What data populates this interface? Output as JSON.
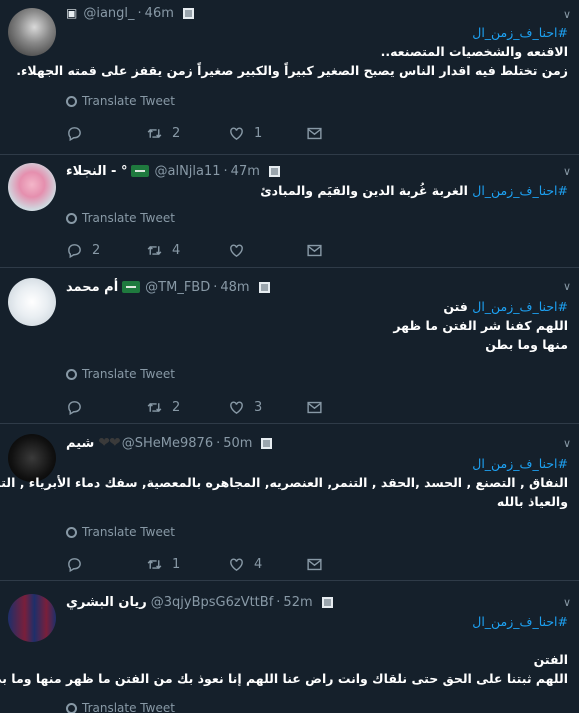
{
  "tweets": [
    {
      "name": "",
      "handle": "@iangl_",
      "time": "46m",
      "text_lines": [
        "#احنا_ف_زمن_ال",
        "الاقنعه والشخصيات المتصنعه..",
        "زمن تختلط فيه اقدار الناس يصبح الصغير كبيراً والكبير صغيراً زمن يقفز على قمته الجهلاء."
      ],
      "translate_label": "Translate Tweet",
      "replies": "",
      "retweets": "2",
      "likes": "1"
    },
    {
      "name": "النجلاء - °",
      "handle": "@alNjla11",
      "time": "47m",
      "text_lines": [
        "#احنا_ف_زمن_ال  الغربة غُربة الدين والقيَم والمبادئ"
      ],
      "translate_label": "Translate Tweet",
      "replies": "2",
      "retweets": "4",
      "likes": ""
    },
    {
      "name": "أم محمد",
      "handle": "@TM_FBD",
      "time": "48m",
      "text_lines": [
        "#احنا_ف_زمن_ال فتن",
        "اللهم كفنا شر الفتن ما ظهر",
        "منها وما بطن"
      ],
      "translate_label": "Translate Tweet",
      "replies": "",
      "retweets": "2",
      "likes": "3"
    },
    {
      "name": "شيم",
      "handle": "@SHeMe9876",
      "time": "50m",
      "text_lines": [
        "#احنا_ف_زمن_ال",
        "النفاق , التصنع , الحسد ,الحقد , التنمر, العنصريه, المجاهره بالمعصية, سفك دماء الأبرياء , التشهير بالفضايح",
        "والعياذ بالله"
      ],
      "translate_label": "Translate Tweet",
      "replies": "",
      "retweets": "1",
      "likes": "4"
    },
    {
      "name": "ريان البشري",
      "handle": "@3qjyBpsG6zVttBf",
      "time": "52m",
      "text_lines": [
        "#احنا_ف_زمن_ال",
        "",
        "الفتن",
        "اللهم ثبتنا على الحق حتى نلقاك وانت راض عنا اللهم إنا نعوذ بك من الفتن ما ظهر منها وما بطن"
      ],
      "translate_label": "Translate Tweet",
      "replies": "",
      "retweets": "",
      "likes": ""
    }
  ],
  "icons": {
    "reply": "reply-icon",
    "retweet": "retweet-icon",
    "like": "like-icon",
    "message": "message-icon",
    "globe": "globe-icon",
    "caret": "chevron-down-icon"
  },
  "colors": {
    "background": "#15202b",
    "text_secondary": "#8899a6",
    "hashtag": "#1da1f2",
    "divider": "#2f3b48"
  }
}
